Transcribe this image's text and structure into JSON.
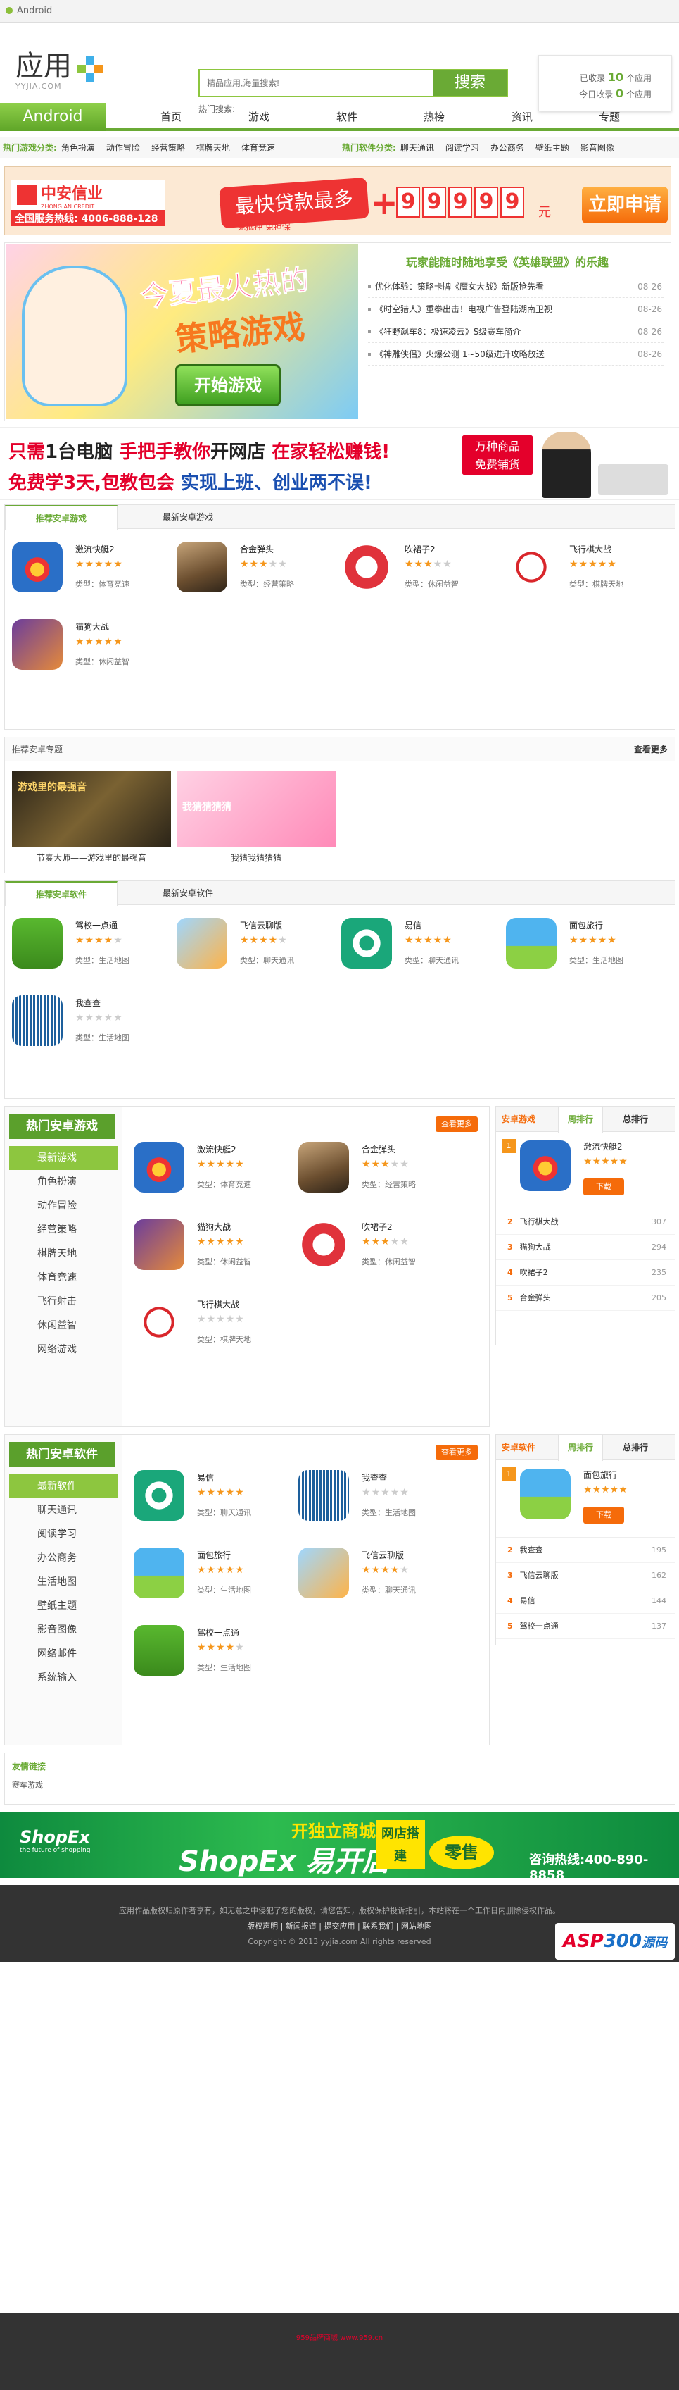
{
  "window": {
    "title": "Android"
  },
  "brand": {
    "cn": "应用",
    "en": "YYJIA.COM"
  },
  "search": {
    "placeholder": "精品应用,海量搜索!",
    "button": "搜索",
    "hot_label": "热门搜索:"
  },
  "stats": {
    "pre1": "已收录",
    "count1": "10",
    "post1": "个应用",
    "pre2": "今日收录",
    "count2": "0",
    "post2": "个应用"
  },
  "nav": {
    "home_label": "Android",
    "items": [
      "首页",
      "游戏",
      "软件",
      "热榜",
      "资讯",
      "专题"
    ]
  },
  "categories": {
    "game_label": "热门游戏分类:",
    "games": [
      "角色扮演",
      "动作冒险",
      "经营策略",
      "棋牌天地",
      "体育竞速"
    ],
    "soft_label": "热门软件分类:",
    "softs": [
      "聊天通讯",
      "阅读学习",
      "办公商务",
      "壁纸主题",
      "影音图像"
    ]
  },
  "banner1": {
    "brand": "中安信业",
    "brand_en": "ZHONG AN CREDIT",
    "hotline": "全国服务热线: 4006-888-128",
    "slogan": "最快贷款最多",
    "sub": "免抵押 免担保",
    "plus": "+",
    "digits": [
      "9",
      "9",
      "9",
      "9",
      "9"
    ],
    "yuan": "元",
    "apply": "立即申请"
  },
  "featured": {
    "image_line1": "今夏最火热的",
    "image_line2": "策略游戏",
    "image_button": "开始游戏",
    "title": "玩家能随时随地享受《英雄联盟》的乐趣",
    "news": [
      {
        "text": "优化体验：策略卡牌《魔女大战》新版抢先看",
        "date": "08-26"
      },
      {
        "text": "《时空猎人》重拳出击！电视广告登陆湖南卫视",
        "date": "08-26"
      },
      {
        "text": "《狂野飙车8：极速凌云》S级赛车简介",
        "date": "08-26"
      },
      {
        "text": "《神雕侠侣》火爆公测 1~50级进升攻略放送",
        "date": "08-26"
      }
    ]
  },
  "banner2": {
    "line1a": "只需",
    "line1b": "1台电脑",
    "line1c": " 手把手教你",
    "line1d": "开网店",
    "line1e": " 在家轻松赚钱!",
    "line2a": "免费学3天,包教包会",
    "line2b": "  实现上班、创业两不误!",
    "tag1": "万种商品",
    "tag2": "免费铺货",
    "footer": "959品牌商城 www.959.cn"
  },
  "game_panel": {
    "tabs": [
      "推荐安卓游戏",
      "最新安卓游戏"
    ],
    "apps": [
      {
        "name": "激流快艇2",
        "rating": 4.5,
        "type": "类型：体育竞速",
        "icon": "boat-icon"
      },
      {
        "name": "合金弹头",
        "rating": 3,
        "type": "类型：经营策略",
        "icon": "soldier-icon"
      },
      {
        "name": "吹裙子2",
        "rating": 3,
        "type": "类型：休闲益智",
        "icon": "skirt-icon"
      },
      {
        "name": "飞行棋大战",
        "rating": 4.5,
        "type": "类型：棋牌天地",
        "icon": "plane-icon"
      },
      {
        "name": "猫狗大战",
        "rating": 4.5,
        "type": "类型：休闲益智",
        "icon": "catdog-icon"
      }
    ]
  },
  "topics": {
    "header": "推荐安卓专题",
    "more": "查看更多",
    "items": [
      {
        "caption": "节奏大师——游戏里的最强音",
        "image_text": "游戏里的最强音"
      },
      {
        "caption": "我猜我猜猜猜",
        "image_text": "我猜猜猜猜"
      }
    ]
  },
  "soft_panel": {
    "tabs": [
      "推荐安卓软件",
      "最新安卓软件"
    ],
    "apps": [
      {
        "name": "驾校一点通",
        "rating": 3.5,
        "type": "类型：生活地图",
        "icon": "driving-icon"
      },
      {
        "name": "飞信云聊版",
        "rating": 3.5,
        "type": "类型：聊天通讯",
        "icon": "fetion-icon"
      },
      {
        "name": "易信",
        "rating": 4.5,
        "type": "类型：聊天通讯",
        "icon": "yixin-icon"
      },
      {
        "name": "面包旅行",
        "rating": 4.5,
        "type": "类型：生活地图",
        "icon": "travel-icon"
      },
      {
        "name": "我查查",
        "rating": 0,
        "type": "类型：生活地图",
        "icon": "barcode-icon"
      }
    ]
  },
  "hot_games": {
    "title": "热门安卓游戏",
    "menu": [
      "最新游戏",
      "角色扮演",
      "动作冒险",
      "经营策略",
      "棋牌天地",
      "体育竞速",
      "飞行射击",
      "休闲益智",
      "网络游戏"
    ],
    "more": "查看更多",
    "apps": [
      {
        "name": "激流快艇2",
        "rating": 4.5,
        "type": "类型：体育竞速",
        "icon": "boat-icon"
      },
      {
        "name": "合金弹头",
        "rating": 3,
        "type": "类型：经营策略",
        "icon": "soldier-icon"
      },
      {
        "name": "猫狗大战",
        "rating": 4.5,
        "type": "类型：休闲益智",
        "icon": "catdog-icon"
      },
      {
        "name": "吹裙子2",
        "rating": 3,
        "type": "类型：休闲益智",
        "icon": "skirt-icon"
      },
      {
        "name": "飞行棋大战",
        "rating": 0,
        "type": "类型：棋牌天地",
        "icon": "plane-icon"
      }
    ],
    "rank": {
      "tabs": [
        "安卓游戏",
        "周排行",
        "总排行"
      ],
      "top": {
        "rank": "1",
        "name": "激流快艇2",
        "rating": 4.5,
        "download": "下载",
        "icon": "boat-icon"
      },
      "list": [
        {
          "rank": "2",
          "name": "飞行棋大战",
          "count": "307"
        },
        {
          "rank": "3",
          "name": "猫狗大战",
          "count": "294"
        },
        {
          "rank": "4",
          "name": "吹裙子2",
          "count": "235"
        },
        {
          "rank": "5",
          "name": "合金弹头",
          "count": "205"
        }
      ]
    }
  },
  "hot_soft": {
    "title": "热门安卓软件",
    "menu": [
      "最新软件",
      "聊天通讯",
      "阅读学习",
      "办公商务",
      "生活地图",
      "壁纸主题",
      "影音图像",
      "网络邮件",
      "系统输入"
    ],
    "more": "查看更多",
    "apps": [
      {
        "name": "易信",
        "rating": 4.5,
        "type": "类型：聊天通讯",
        "icon": "yixin-icon"
      },
      {
        "name": "我查查",
        "rating": 0,
        "type": "类型：生活地图",
        "icon": "barcode-icon"
      },
      {
        "name": "面包旅行",
        "rating": 4.5,
        "type": "类型：生活地图",
        "icon": "travel-icon"
      },
      {
        "name": "飞信云聊版",
        "rating": 3.5,
        "type": "类型：聊天通讯",
        "icon": "fetion-icon"
      },
      {
        "name": "驾校一点通",
        "rating": 3.5,
        "type": "类型：生活地图",
        "icon": "driving-icon"
      }
    ],
    "rank": {
      "tabs": [
        "安卓软件",
        "周排行",
        "总排行"
      ],
      "top": {
        "rank": "1",
        "name": "面包旅行",
        "rating": 4.5,
        "download": "下载",
        "icon": "travel-icon"
      },
      "list": [
        {
          "rank": "2",
          "name": "我查查",
          "count": "195"
        },
        {
          "rank": "3",
          "name": "飞信云聊版",
          "count": "162"
        },
        {
          "rank": "4",
          "name": "易信",
          "count": "144"
        },
        {
          "rank": "5",
          "name": "驾校一点通",
          "count": "137"
        }
      ]
    }
  },
  "friend_links": {
    "title": "友情链接",
    "links": [
      "赛车游戏"
    ]
  },
  "banner3": {
    "brand": "ShopEx",
    "brand_sub": "the future of shopping",
    "line1": "开独立商城",
    "line2": "ShopEx 易开店",
    "box": "网店搭建",
    "ls": "零售",
    "tel": "咨询热线:400-890-8858"
  },
  "footer": {
    "line1": "应用作品版权归原作者享有，如无意之中侵犯了您的版权，请您告知，版权保护投诉指引，本站将在一个工作日内删除侵权作品。",
    "line2": "版权声明 | 新闻报道 | 提交应用 | 联系我们 | 网站地图",
    "line3": "Copyright © 2013 yyjia.com All rights reserved"
  },
  "watermark": {
    "a": "ASP",
    "b": "300",
    "c": "源码"
  },
  "colors": {
    "accent": "#6aaa35",
    "orange": "#f56b0a",
    "star": "#f5961b"
  }
}
